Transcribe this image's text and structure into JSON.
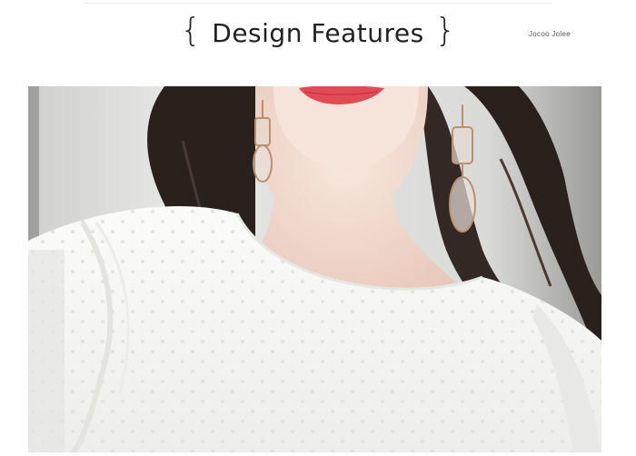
{
  "heading": {
    "open_brace": "{",
    "title": "Design Features",
    "close_brace": "}"
  },
  "brand": "Jocoo Jolee",
  "photo": {
    "subject": "product-photo",
    "colors": {
      "blouse": "#f7f7f5",
      "skin": "#f3ddd2",
      "hair": "#2a211d",
      "lips": "#e24a55",
      "background": "#d9d9d7"
    }
  }
}
